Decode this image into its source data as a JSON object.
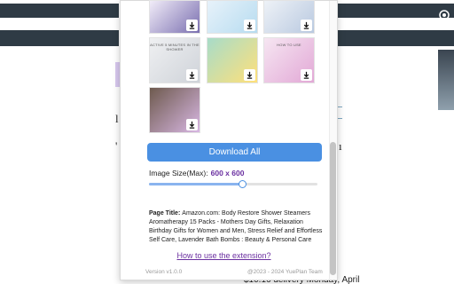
{
  "background": {
    "bottom_text": "$10.16 delivery Monday, April"
  },
  "popup": {
    "thumbnails": [
      {
        "name": "bloom-shower-steamers-image",
        "caption": "",
        "tone": "#7a6fb0",
        "accent": "#f1ecf8"
      },
      {
        "name": "lavender-essential-oil-image",
        "caption": "",
        "tone": "#b7dcf0",
        "accent": "#e7f2fa"
      },
      {
        "name": "bath-bomb-jars-image",
        "caption": "",
        "tone": "#b9c9e0",
        "accent": "#eef2f7"
      },
      {
        "name": "women-shower-image",
        "caption": "ACTIVE 5 MINUTES IN THE SHOWER",
        "tone": "#cfd3d9",
        "accent": "#eff0f2"
      },
      {
        "name": "colorful-tablets-grid-image",
        "caption": "",
        "tone": "#ffe07a",
        "accent": "#a7dcc9"
      },
      {
        "name": "how-to-use-image",
        "caption": "HOW TO USE",
        "tone": "#e2a8d6",
        "accent": "#f6e6f2"
      },
      {
        "name": "gift-set-collage-image",
        "caption": "",
        "tone": "#d8b7e3",
        "accent": "#6e5a4e"
      }
    ],
    "download_all_label": "Download All",
    "image_size_label": "Image Size(Max):",
    "image_size_value": "600 x 600",
    "slider_fraction": 0.55,
    "page_title_label": "Page Title:",
    "page_title_text": "Amazon.com: Body Restore Shower Steamers Aromatherapy 15 Packs - Mothers Day Gifts, Relaxation Birthday Gifts for Women and Men, Stress Relief and Effortless Self Care, Lavender Bath Bombs : Beauty & Personal Care",
    "howto_link": "How to use the extension?",
    "version": "Version v1.0.0",
    "copyright": "@2023 - 2024 YuePlan Team"
  },
  "colors": {
    "button": "#4a90e2",
    "accent_purple": "#6a2fa0"
  }
}
